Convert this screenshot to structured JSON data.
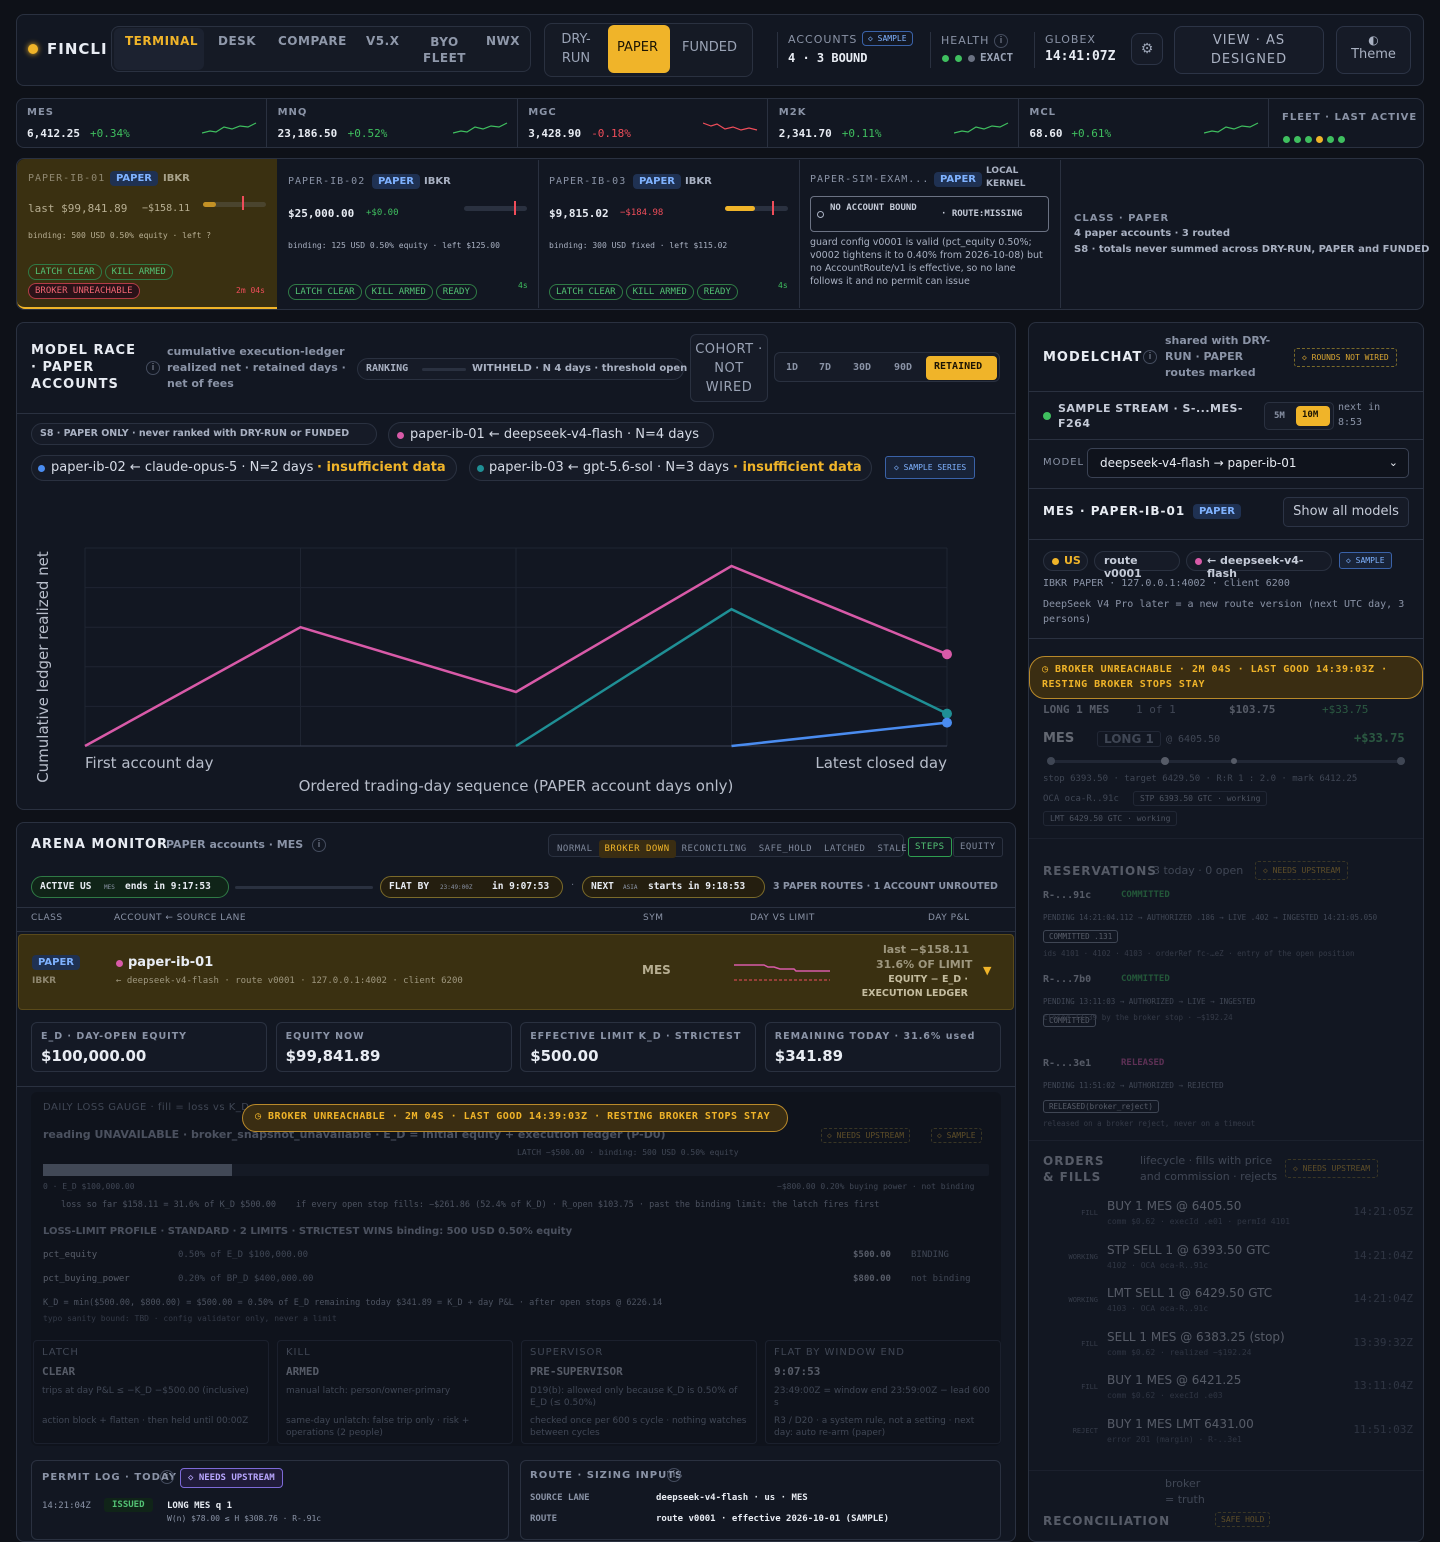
{
  "header": {
    "brand": "FINCLI",
    "tabs": [
      "TERMINAL",
      "DESK",
      "COMPARE",
      "V5.X",
      "BYO FLEET",
      "NWX"
    ],
    "modes": [
      "DRY-RUN",
      "PAPER",
      "FUNDED"
    ],
    "accounts_label": "ACCOUNTS",
    "sample_badge": "◇ SAMPLE",
    "accounts_value": "4 · 3 BOUND",
    "health_label": "HEALTH",
    "health_value": "EXACT",
    "globex_label": "GLOBEX",
    "globex_time": "14:41:07Z",
    "view_button": "VIEW · AS DESIGNED",
    "theme_button": "Theme",
    "theme_icon": "◐"
  },
  "tickers": [
    {
      "sym": "MES",
      "price": "6,412.25",
      "chg": "+0.34%",
      "dir": "up"
    },
    {
      "sym": "MNQ",
      "price": "23,186.50",
      "chg": "+0.52%",
      "dir": "up"
    },
    {
      "sym": "MGC",
      "price": "3,428.90",
      "chg": "-0.18%",
      "dir": "dn"
    },
    {
      "sym": "M2K",
      "price": "2,341.70",
      "chg": "+0.11%",
      "dir": "up"
    },
    {
      "sym": "MCL",
      "price": "68.60",
      "chg": "+0.61%",
      "dir": "up"
    }
  ],
  "fleet_label": "FLEET · LAST ACTIVE",
  "accounts": [
    {
      "name": "PAPER-IB-01",
      "badge": "PAPER",
      "broker": "IBKR",
      "value": "last $99,841.89",
      "delta": "−$158.11",
      "binding": "binding: 500 USD 0.50% equity · left ?",
      "pills": [
        "LATCH CLEAR",
        "KILL ARMED"
      ],
      "alert": "BROKER UNREACHABLE",
      "age": "2m 04s"
    },
    {
      "name": "PAPER-IB-02",
      "badge": "PAPER",
      "broker": "IBKR",
      "value": "$25,000.00",
      "delta": "+$0.00",
      "binding": "binding: 125 USD 0.50% equity · left $125.00",
      "pills": [
        "LATCH CLEAR",
        "KILL ARMED",
        "READY"
      ],
      "age": "4s"
    },
    {
      "name": "PAPER-IB-03",
      "badge": "PAPER",
      "broker": "IBKR",
      "value": "$9,815.02",
      "delta": "−$184.98",
      "binding": "binding: 300 USD fixed · left $115.02",
      "pills": [
        "LATCH CLEAR",
        "KILL ARMED",
        "READY"
      ],
      "age": "4s"
    },
    {
      "name": "PAPER-SIM-EXAM...",
      "badge": "PAPER",
      "broker": "LOCAL KERNEL",
      "noacct": "NO ACCOUNT BOUND",
      "route": "· ROUTE:MISSING",
      "note": "guard config v0001 is valid (pct_equity 0.50%; v0002 tightens it to 0.40% from 2026-10-08) but no AccountRoute/v1 is effective, so no lane follows it and no permit can issue"
    }
  ],
  "class_summary": {
    "title": "CLASS · PAPER",
    "line1": "4 paper accounts · 3 routed",
    "line2": "S8 · totals never summed across DRY-RUN, PAPER and FUNDED"
  },
  "race": {
    "title": "MODEL RACE · PAPER ACCOUNTS",
    "subtitle": "cumulative execution-ledger realized net · retained days · net of fees",
    "ranking": "RANKING",
    "withheld": "WITHHELD · N 4 days · threshold open",
    "cohort": "COHORT · NOT WIRED",
    "ranges": [
      "1D",
      "7D",
      "30D",
      "90D",
      "RETAINED"
    ],
    "scope": "S8 · PAPER ONLY · never ranked with DRY-RUN or FUNDED",
    "lanes": [
      "paper-ib-01 ← deepseek-v4-flash · N=4 days",
      "paper-ib-02 ← claude-opus-5 · N=2 days",
      "paper-ib-03 ← gpt-5.6-sol · N=3 days"
    ],
    "insufficient": "· insufficient data",
    "sample_series": "◇ SAMPLE SERIES"
  },
  "chart_data": {
    "type": "line",
    "xlabel": "Ordered trading-day sequence (PAPER account days only)",
    "ylabel": "Cumulative ledger realized net",
    "x_tick_labels": [
      "First account day",
      "Latest closed day"
    ],
    "x": [
      0,
      1,
      2,
      3,
      4
    ],
    "series": [
      {
        "name": "paper-ib-01 ← deepseek-v4-flash",
        "color": "#d85aa8",
        "values": [
          0,
          66,
          30,
          100,
          51
        ]
      },
      {
        "name": "paper-ib-03 ← gpt-5.6-sol",
        "color": "#1f8f95",
        "values": [
          null,
          null,
          0,
          76,
          18
        ]
      },
      {
        "name": "paper-ib-02 ← claude-opus-5",
        "color": "#4a8cf0",
        "values": [
          null,
          null,
          null,
          0,
          13
        ]
      }
    ],
    "ylim": [
      0,
      110
    ],
    "grid": true
  },
  "arena": {
    "title": "ARENA MONITOR",
    "subtitle": "PAPER accounts · MES",
    "states": [
      "NORMAL",
      "BROKER DOWN",
      "RECONCILING",
      "SAFE_HOLD",
      "LATCHED",
      "STALE"
    ],
    "views": [
      "STEPS",
      "EQUITY"
    ],
    "active": "ACTIVE US",
    "active_sub": "MES",
    "active_ends": "ends in 9:17:53",
    "flat": "FLAT BY",
    "flat_time": "23:49:00Z",
    "flat_in": "in 9:07:53",
    "next": "NEXT",
    "next_sub": "ASIA",
    "next_starts": "starts in 9:18:53",
    "routes": "3 PAPER ROUTES · 1 ACCOUNT UNROUTED",
    "cols": [
      "CLASS",
      "ACCOUNT ← SOURCE LANE",
      "SYM",
      "DAY VS LIMIT",
      "DAY P&L"
    ],
    "row": {
      "badge": "PAPER",
      "broker": "IBKR",
      "account": "paper-ib-01",
      "lane": "← deepseek-v4-flash · route v0001 · 127.0.0.1:4002 · client 6200",
      "sym": "MES",
      "pnl1": "last −$158.11",
      "pnl2": "31.6% OF LIMIT",
      "pnl3": "EQUITY − E_D · EXECUTION LEDGER"
    },
    "stats": [
      {
        "label": "E_D · DAY-OPEN EQUITY",
        "value": "$100,000.00"
      },
      {
        "label": "EQUITY NOW",
        "value": "$99,841.89"
      },
      {
        "label": "EFFECTIVE LIMIT K_D · STRICTEST",
        "value": "$500.00"
      },
      {
        "label": "REMAINING TODAY · 31.6% used",
        "value": "$341.89"
      }
    ],
    "warn": "◷ BROKER UNREACHABLE · 2M 04S · LAST GOOD 14:39:03Z · RESTING BROKER STOPS STAY",
    "gauge": {
      "title": "DAILY LOSS GAUGE · fill = loss vs K_D",
      "reading": "reading UNAVAILABLE · broker_snapshot_unavailable · E_D = initial equity + execution ledger (P-D0)",
      "latch": "LATCH −$500.00 · binding: 500 USD 0.50% equity",
      "left": "0 · E_D $100,000.00",
      "right": "−$800.00 0.20% buying power · not binding",
      "loss": "loss so far $158.11 = 31.6% of K_D $500.00",
      "stopfill": "if every open stop fills: −$261.86 (52.4% of K_D) · R_open $103.75 · past the binding limit: the latch fires first",
      "profile": "LOSS-LIMIT PROFILE · STANDARD · 2 LIMITS · STRICTEST WINS  binding: 500 USD 0.50% equity",
      "p1k": "pct_equity",
      "p1v": "0.50% of E_D $100,000.00",
      "p1a": "$500.00",
      "p1s": "BINDING",
      "p2k": "pct_buying_power",
      "p2v": "0.20% of BP_D $400,000.00",
      "p2a": "$800.00",
      "p2s": "not binding",
      "formula": "K_D = min($500.00, $800.00) = $500.00 = 0.50% of E_D   remaining today $341.89 = K_D + day P&L · after open stops @ 6226.14",
      "typo": "typo sanity bound: TBD · config validator only, never a limit",
      "cells": [
        {
          "h": "LATCH",
          "v": "CLEAR",
          "d": "trips at day P&L ≤ −K_D −$500.00 (inclusive)",
          "e": "action block + flatten · then held until 00:00Z"
        },
        {
          "h": "KILL",
          "v": "ARMED",
          "d": "manual latch: person/owner-primary",
          "e": "same-day unlatch: false trip only · risk + operations (2 people)"
        },
        {
          "h": "SUPERVISOR",
          "v": "PRE-SUPERVISOR",
          "d": "D19(b): allowed only because K_D is 0.50% of E_D (≤ 0.50%)",
          "e": "checked once per 600 s cycle · nothing watches between cycles"
        },
        {
          "h": "FLAT BY WINDOW END",
          "v": "9:07:53",
          "d": "23:49:00Z = window end 23:59:00Z − lead 600 s",
          "e": "R3 / D20 · a system rule, not a setting · next day: auto re-arm (paper)"
        }
      ]
    },
    "permit": {
      "title": "PERMIT LOG · TODAY",
      "tag": "◇ NEEDS UPSTREAM",
      "time": "14:21:04Z",
      "status": "ISSUED",
      "text": "LONG MES q 1",
      "sub": "W(n) $78.00 ≤ H $308.76 · R-.91c"
    },
    "route": {
      "title": "ROUTE · SIZING INPUTS",
      "k1": "SOURCE LANE",
      "v1": "deepseek-v4-flash · us · MES",
      "k2": "ROUTE",
      "v2": "route v0001 · effective 2026-10-01 (SAMPLE)"
    }
  },
  "modelchat": {
    "title": "MODELCHAT",
    "subtitle": "shared with DRY-RUN · PAPER routes marked",
    "rounds": "◇ ROUNDS NOT WIRED",
    "stream": "SAMPLE STREAM · S-...MES-F264",
    "ranges": [
      "5M",
      "10M"
    ],
    "next": "next in",
    "next_time": "8:53",
    "model_label": "MODEL",
    "model_value": "deepseek-v4-flash → paper-ib-01",
    "pane_title": "MES · PAPER-IB-01",
    "pane_badge": "PAPER",
    "show_all": "Show all models",
    "chips": [
      "US",
      "route v0001",
      "← deepseek-v4-flash",
      "◇ SAMPLE"
    ],
    "info1": "IBKR PAPER · 127.0.0.1:4002 · client 6200",
    "info2": "DeepSeek V4 Pro later = a new route version (next UTC day, 3 persons)",
    "warn1": "◷ BROKER UNREACHABLE · 2M 04S · LAST GOOD 14:39:03Z ·",
    "warn2": "RESTING BROKER STOPS STAY",
    "pos_label": "LONG 1 MES",
    "pos_of": "1 of 1",
    "pos_r": "$103.75",
    "pos_pnl": "+$33.75",
    "mes": "MES",
    "mes_pos": "LONG 1",
    "mes_at": "@ 6405.50",
    "mes_pnl": "+$33.75",
    "stops": "stop 6393.50 · target 6429.50 · R:R 1 : 2.0 · mark 6412.25",
    "oca": "OCA oca-R..91c",
    "oca_tag1": "STP 6393.50 GTC · working",
    "oca_tag2": "LMT 6429.50 GTC · working",
    "res_title": "RESERVATIONS",
    "res_sub": "3 today · 0 open",
    "res_tag": "◇ NEEDS UPSTREAM",
    "reservations": [
      {
        "id": "R-...91c",
        "st": "COMMITTED",
        "flow": "PENDING 14:21:04.112 → AUTHORIZED .186 → LIVE .402 → INGESTED 14:21:05.050",
        "box": "COMMITTED .131",
        "note": "ids 4101 · 4102 · 4103 · orderRef fc-…eZ · entry of the open position"
      },
      {
        "id": "R-...7b0",
        "st": "COMMITTED",
        "flow": "PENDING 13:11:03 → AUTHORIZED → LIVE → INGESTED",
        "box": "COMMITTED",
        "note": "closed 13:39 by the broker stop · −$192.24"
      },
      {
        "id": "R-...3e1",
        "st": "RELEASED",
        "flow": "PENDING 11:51:02 → AUTHORIZED → REJECTED",
        "box": "RELEASED(broker_reject)",
        "note": "released on a broker reject, never on a timeout"
      }
    ],
    "ord_title": "ORDERS & FILLS",
    "ord_sub": "lifecycle · fills with price and commission · rejects",
    "ord_tag": "◇ NEEDS UPSTREAM",
    "orders": [
      {
        "k": "FILL",
        "t": "BUY 1 MES @ 6405.50",
        "s": "comm $0.62 · execId .e01 · permId 4101",
        "r": "14:21:05Z"
      },
      {
        "k": "WORKING",
        "t": "STP SELL 1 @ 6393.50 GTC",
        "s": "4102 · OCA oca-R..91c",
        "r": "14:21:04Z"
      },
      {
        "k": "WORKING",
        "t": "LMT SELL 1 @ 6429.50 GTC",
        "s": "4103 · OCA oca-R..91c",
        "r": "14:21:04Z"
      },
      {
        "k": "FILL",
        "t": "SELL 1 MES @ 6383.25 (stop)",
        "s": "comm $0.62 · realized −$192.24",
        "r": "13:39:32Z"
      },
      {
        "k": "FILL",
        "t": "BUY 1 MES @ 6421.25",
        "s": "comm $0.62 · execId .e03",
        "r": "13:11:04Z"
      },
      {
        "k": "REJECT",
        "t": "BUY 1 MES LMT 6431.00",
        "s": "error 201 (margin) · R-..3e1",
        "r": "11:51:03Z"
      }
    ],
    "recon": "RECONCILIATION",
    "recon_sub": "broker = truth",
    "recon_tag": "SAFE HOLD"
  }
}
